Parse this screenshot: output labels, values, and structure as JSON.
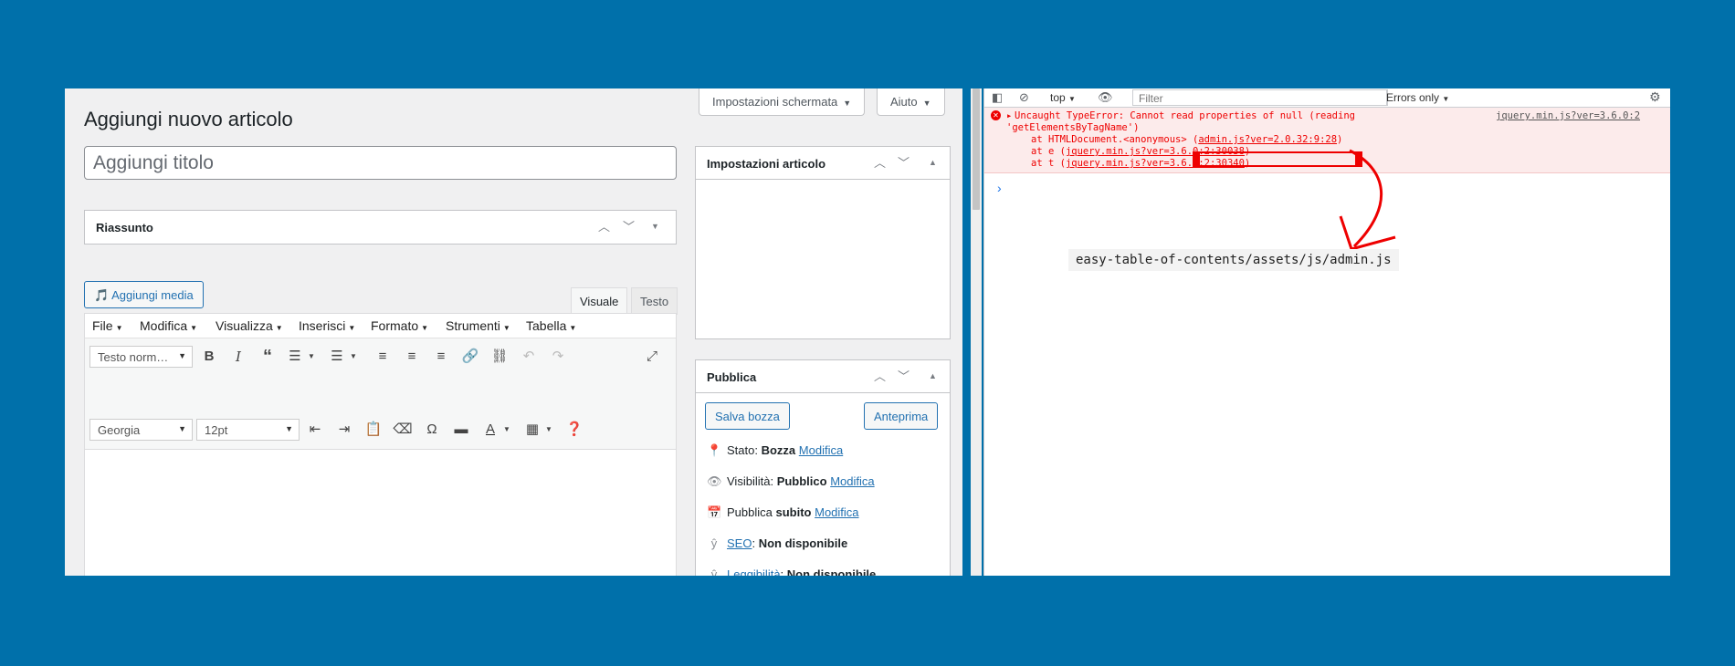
{
  "wp": {
    "page_title": "Aggiungi nuovo articolo",
    "screen_options_label": "Impostazioni schermata",
    "help_label": "Aiuto",
    "title_placeholder": "Aggiungi titolo",
    "excerpt_title": "Riassunto",
    "add_media_label": "Aggiungi media",
    "tab_visual": "Visuale",
    "tab_text": "Testo",
    "menu": [
      "File",
      "Modifica",
      "Visualizza",
      "Inserisci",
      "Formato",
      "Strumenti",
      "Tabella"
    ],
    "format_select": "Testo norm…",
    "font_select": "Georgia",
    "size_select": "12pt",
    "settings_box_title": "Impostazioni articolo",
    "publish_box_title": "Pubblica",
    "save_draft": "Salva bozza",
    "preview": "Anteprima",
    "status_label": "Stato:",
    "status_value": "Bozza",
    "visibility_label": "Visibilità:",
    "visibility_value": "Pubblico",
    "publish_label": "Pubblica",
    "publish_value": "subito",
    "edit_link": "Modifica",
    "seo_link": "SEO",
    "seo_value": "Non disponibile",
    "readability_link": "Leggibilità",
    "readability_value": "Non disponibile"
  },
  "devtools": {
    "context": "top",
    "filter_placeholder": "Filter",
    "level": "Errors only",
    "error_line1": "Uncaught TypeError: Cannot read properties of null (reading",
    "error_line2": "'getElementsByTagName')",
    "stack1_prefix": "at HTMLDocument.<anonymous> (",
    "stack1_link": "admin.js?ver=2.0.32:9:28",
    "stack2_prefix": "at e (",
    "stack2_link": "jquery.min.js?ver=3.6.0:2:30038",
    "stack3_prefix": "at t (",
    "stack3_link": "jquery.min.js?ver=3.6.0:2:30340",
    "source_link": "jquery.min.js?ver=3.6.0:2",
    "annotation": "easy-table-of-contents/assets/js/admin.js"
  },
  "colors": {
    "background": "#0070aa",
    "wp_link": "#2271b1",
    "error_red": "#e00000"
  },
  "icons": [
    "media-icon",
    "bold-icon",
    "italic-icon",
    "blockquote-icon",
    "bullet-list-icon",
    "numbered-list-icon",
    "align-left-icon",
    "align-center-icon",
    "align-right-icon",
    "link-icon",
    "unlink-icon",
    "undo-icon",
    "redo-icon",
    "fullscreen-icon",
    "outdent-icon",
    "indent-icon",
    "paste-icon",
    "clear-format-icon",
    "omega-icon",
    "horizontal-rule-icon",
    "text-color-icon",
    "table-icon",
    "help-icon",
    "pin-icon",
    "eye-icon",
    "calendar-icon",
    "yoast-icon",
    "gear-icon",
    "clear-console-icon",
    "sidebar-toggle-icon",
    "error-icon",
    "arrow-annotation"
  ]
}
